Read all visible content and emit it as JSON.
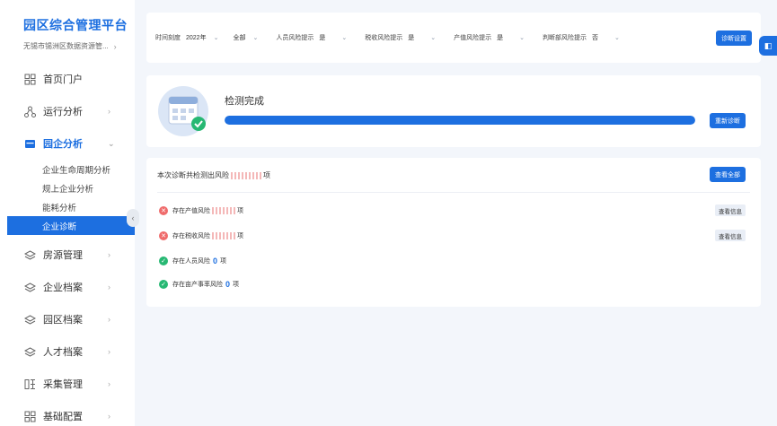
{
  "brand": {
    "title": "园区综合管理平台",
    "subtitle": "无锡市锡洲区数据资源管...",
    "chevron": "›"
  },
  "sidebar": {
    "items": [
      {
        "label": "首页门户",
        "icon": "grid-icon",
        "arrow": ""
      },
      {
        "label": "运行分析",
        "icon": "network-icon",
        "arrow": "›"
      },
      {
        "label": "园企分析",
        "icon": "folder-icon",
        "arrow": "⌄"
      },
      {
        "label": "房源管理",
        "icon": "layers-icon",
        "arrow": "›"
      },
      {
        "label": "企业档案",
        "icon": "layers-icon",
        "arrow": "›"
      },
      {
        "label": "园区档案",
        "icon": "layers-icon",
        "arrow": "›"
      },
      {
        "label": "人才档案",
        "icon": "layers-icon",
        "arrow": "›"
      },
      {
        "label": "采集管理",
        "icon": "data-icon",
        "arrow": "›"
      },
      {
        "label": "基础配置",
        "icon": "grid-icon",
        "arrow": "›"
      }
    ],
    "sub_items": [
      "企业生命周期分析",
      "规上企业分析",
      "能耗分析",
      "企业诊断"
    ],
    "collapse": "‹"
  },
  "filters": [
    {
      "label": "时间刻度",
      "value": "2022年"
    },
    {
      "label": "",
      "value": "全部"
    },
    {
      "label": "人员风险提示",
      "value": "是"
    },
    {
      "label": "税收风险提示",
      "value": "是"
    },
    {
      "label": "产值风险提示",
      "value": "是"
    },
    {
      "label": "判断部风险提示",
      "value": "否"
    }
  ],
  "filter_button": "诊断设置",
  "float_icon": "◧",
  "detect": {
    "title": "检测完成",
    "progress": 1.0,
    "button": "重新诊断"
  },
  "results": {
    "head_prefix": "本次诊断共检测出风险",
    "head_suffix": "项",
    "view_all": "查看全部",
    "rows": [
      {
        "status": "bad",
        "symbol": "✕",
        "text": "存在产值风险",
        "count": "",
        "unit": "项",
        "detail": "查看信息"
      },
      {
        "status": "bad",
        "symbol": "✕",
        "text": "存在税收风险",
        "count": "",
        "unit": "项",
        "detail": "查看信息"
      },
      {
        "status": "good",
        "symbol": "✓",
        "text": "存在人员风险",
        "count": "0",
        "unit": "项",
        "detail": ""
      },
      {
        "status": "good",
        "symbol": "✓",
        "text": "存在亩产事率风险",
        "count": "0",
        "unit": "项",
        "detail": ""
      }
    ]
  }
}
